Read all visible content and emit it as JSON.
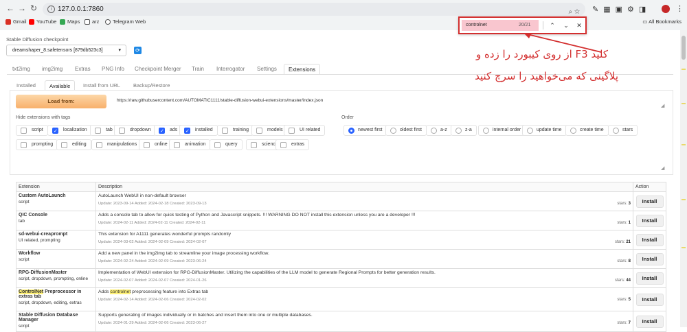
{
  "browser": {
    "url": "127.0.0.1:7860",
    "bookmarks": [
      {
        "label": "Gmail",
        "color": "#d93025"
      },
      {
        "label": "YouTube",
        "color": "#ff0000"
      },
      {
        "label": "Maps",
        "color": "#34a853"
      },
      {
        "label": "arz",
        "color": "#5f6368"
      },
      {
        "label": "Telegram Web",
        "color": "#5f6368"
      }
    ],
    "all_bookmarks": "All Bookmarks"
  },
  "find_bar": {
    "query": "controlnet",
    "count": "20/21"
  },
  "annotation": {
    "line1": "کلید F3 از روی کیبورد را زده و",
    "line2": "پلاگینی که می‌خواهید را سرچ کنید",
    "color": "#d32f2f"
  },
  "checkpoint": {
    "label": "Stable Diffusion checkpoint",
    "value": "dreamshaper_8.safetensors [879db523c3]"
  },
  "main_tabs": [
    "txt2img",
    "img2img",
    "Extras",
    "PNG Info",
    "Checkpoint Merger",
    "Train",
    "Interrogator",
    "Settings",
    "Extensions"
  ],
  "active_main_tab": "Extensions",
  "sub_tabs": [
    "Installed",
    "Available",
    "Install from URL",
    "Backup/Restore"
  ],
  "active_sub_tab": "Available",
  "load_from": {
    "button": "Load from:",
    "url": "https://raw.githubusercontent.com/AUTOMATIC1111/stable-diffusion-webui-extensions/master/index.json"
  },
  "hide_tags": {
    "label": "Hide extensions with tags",
    "items": [
      {
        "label": "script",
        "checked": false
      },
      {
        "label": "localization",
        "checked": true
      },
      {
        "label": "tab",
        "checked": false
      },
      {
        "label": "dropdown",
        "checked": false
      },
      {
        "label": "ads",
        "checked": true
      },
      {
        "label": "installed",
        "checked": true
      },
      {
        "label": "training",
        "checked": false
      },
      {
        "label": "models",
        "checked": false
      },
      {
        "label": "UI related",
        "checked": false
      },
      {
        "label": "prompting",
        "checked": false
      },
      {
        "label": "editing",
        "checked": false
      },
      {
        "label": "manipulations",
        "checked": false
      },
      {
        "label": "online",
        "checked": false
      },
      {
        "label": "animation",
        "checked": false
      },
      {
        "label": "query",
        "checked": false
      },
      {
        "label": "science",
        "checked": false
      },
      {
        "label": "extras",
        "checked": false
      }
    ]
  },
  "order": {
    "label": "Order",
    "items": [
      {
        "label": "newest first",
        "selected": true
      },
      {
        "label": "oldest first",
        "selected": false
      },
      {
        "label": "a-z",
        "selected": false
      },
      {
        "label": "z-a",
        "selected": false
      },
      {
        "label": "internal order",
        "selected": false
      },
      {
        "label": "update time",
        "selected": false
      },
      {
        "label": "create time",
        "selected": false
      },
      {
        "label": "stars",
        "selected": false
      }
    ]
  },
  "table": {
    "headers": {
      "extension": "Extension",
      "description": "Description",
      "action": "Action"
    },
    "install_label": "Install",
    "stars_prefix": "stars:",
    "rows": [
      {
        "name": "Custom AutoLaunch",
        "tags": "script",
        "desc": "AutoLaunch WebUI in non-default browser",
        "meta": "Update: 2023-09-14 Added: 2024-02-18 Created: 2023-09-13",
        "stars": "3"
      },
      {
        "name": "QIC Console",
        "tags": "tab",
        "desc": "Adds a console tab to allow for quick testing of Python and Javascript snippets. !!! WARNING DO NOT install this extension unless you are a developer !!!",
        "meta": "Update: 2024-02-11 Added: 2024-02-11 Created: 2024-02-11",
        "stars": "1"
      },
      {
        "name": "sd-webui-creaprompt",
        "tags": "UI related, prompting",
        "desc": "This extension for A1111 generates wonderful prompts randomly",
        "meta": "Update: 2024-03-02 Added: 2024-02-09 Created: 2024-02-07",
        "stars": "21"
      },
      {
        "name": "Workflow",
        "tags": "script",
        "desc": "Add a new panel in the img2img tab to streamline your image processing workflow.",
        "meta": "Update: 2024-02-24 Added: 2024-02-09 Created: 2023-06-24",
        "stars": "8"
      },
      {
        "name": "RPG-DiffusionMaster",
        "tags": "script, dropdown, prompting, online",
        "desc": "Implementation of WebUI extension for RPG-DiffusionMaster. Utilizing the capabilities of the LLM model to generate Regional Prompts for better generation results.",
        "meta": "Update: 2024-02-07 Added: 2024-02-07 Created: 2024-01-26",
        "stars": "44"
      },
      {
        "name_hl": "ControlNet",
        "name_rest": " Preprocessor in extras tab",
        "tags": "script, dropdown, editing, extras",
        "desc_pre": "Adds ",
        "desc_hl": "controlnet",
        "desc_post": " preprocessing feature into Extras tab",
        "meta": "Update: 2024-02-14 Added: 2024-02-06 Created: 2024-02-02",
        "stars": "5"
      },
      {
        "name": "Stable Diffusion Database Manager",
        "tags": "script",
        "desc": "Supports generating of images individually or in batches and insert them into one or multiple databases.",
        "meta": "Update: 2024-01-29 Added: 2024-02-06 Created: 2023-06-27",
        "stars": "7"
      }
    ]
  }
}
